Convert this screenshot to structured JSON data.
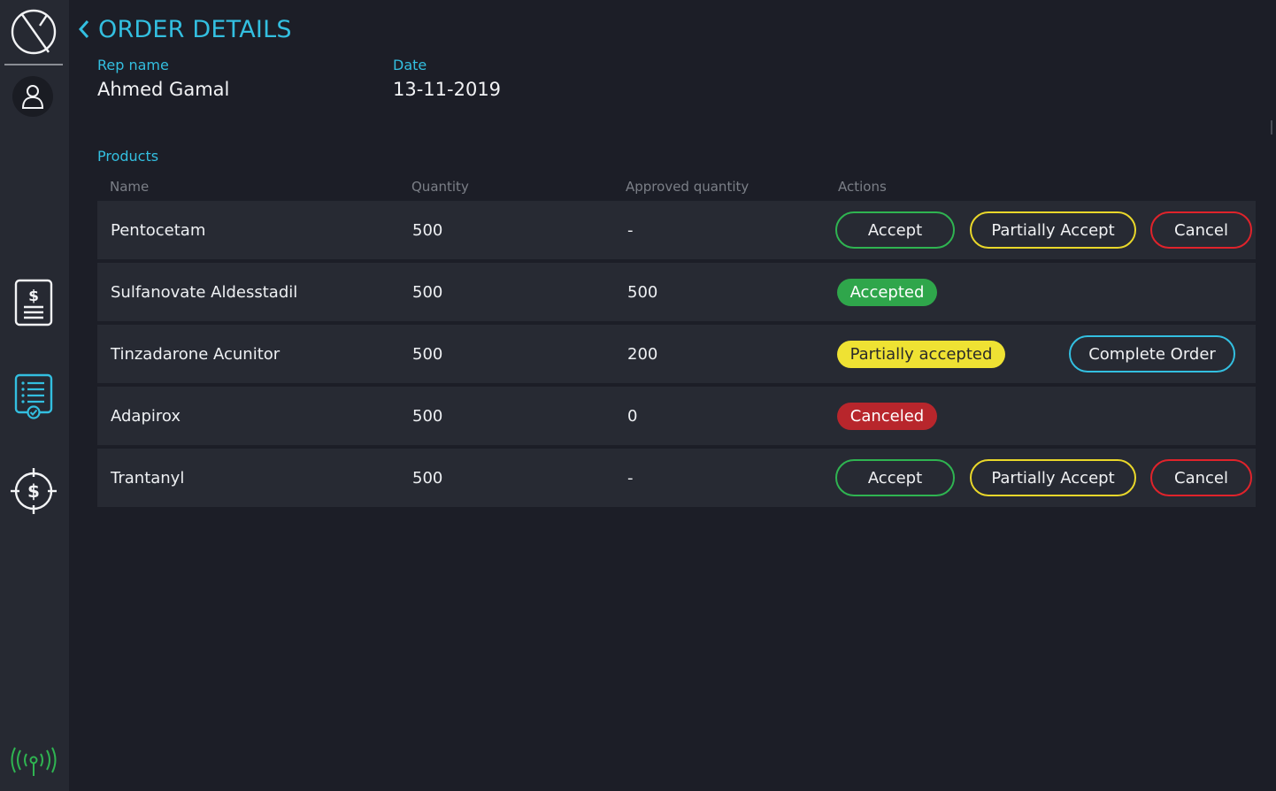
{
  "sidebar": {
    "logo_icon": "no-symbol-logo",
    "items": [
      {
        "name": "user-icon"
      },
      {
        "name": "invoice-dollar-icon"
      },
      {
        "name": "orders-checklist-icon"
      },
      {
        "name": "dollar-target-icon"
      }
    ],
    "status_icon": "signal-broadcast-icon"
  },
  "header": {
    "back_icon": "chevron-left-icon",
    "title": "ORDER DETAILS"
  },
  "info": {
    "rep_label": "Rep name",
    "rep_value": "Ahmed Gamal",
    "date_label": "Date",
    "date_value": "13-11-2019"
  },
  "products": {
    "section_label": "Products",
    "columns": [
      "Name",
      "Quantity",
      "Approved quantity",
      "Actions"
    ],
    "rows": [
      {
        "name": "Pentocetam",
        "quantity": "500",
        "approved": "-",
        "actions": [
          "Accept",
          "Partially Accept",
          "Cancel"
        ]
      },
      {
        "name": "Sulfanovate Aldesstadil",
        "quantity": "500",
        "approved": "500",
        "status": "Accepted"
      },
      {
        "name": "Tinzadarone Acunitor",
        "quantity": "500",
        "approved": "200",
        "status": "Partially accepted",
        "action": "Complete Order"
      },
      {
        "name": "Adapirox",
        "quantity": "500",
        "approved": "0",
        "status": "Canceled"
      },
      {
        "name": "Trantanyl",
        "quantity": "500",
        "approved": "-",
        "actions": [
          "Accept",
          "Partially Accept",
          "Cancel"
        ]
      }
    ]
  },
  "colors": {
    "accent": "#33bfe0",
    "accept": "#2fb451",
    "partial": "#e9d72a",
    "cancel": "#e0232b",
    "background": "#1c1e27",
    "sidebar": "#262932",
    "row": "#272a33"
  }
}
